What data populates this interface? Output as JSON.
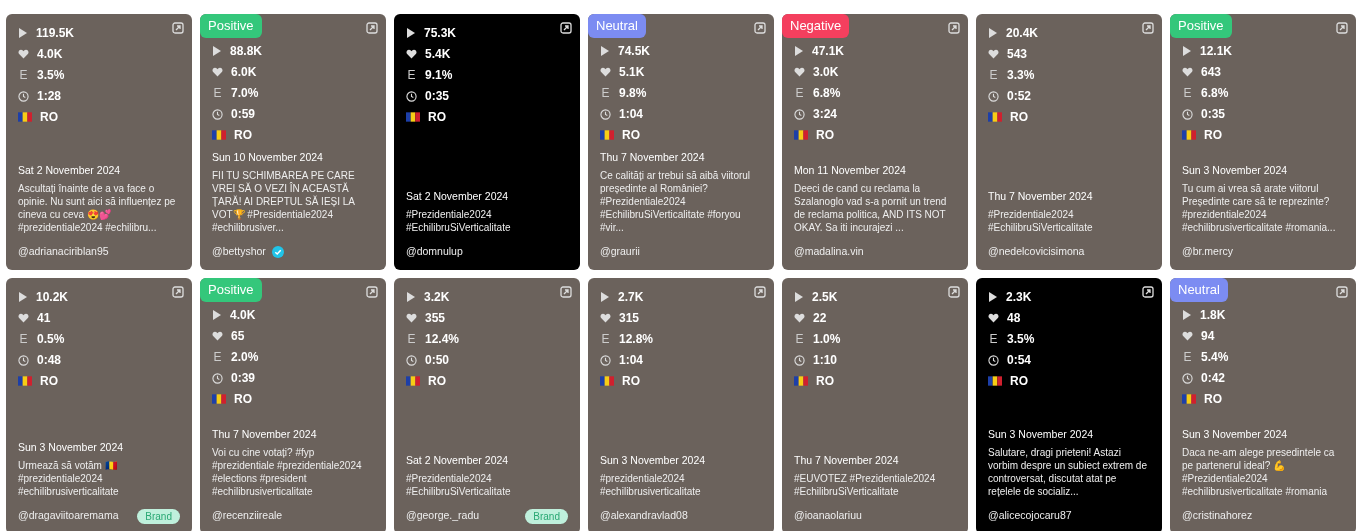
{
  "videos": [
    {
      "thumbnail": true,
      "plays": "119.5K",
      "likes": "4.0K",
      "engagement_label": "E",
      "engagement": "3.5%",
      "duration": "1:28",
      "country": "RO",
      "date": "Sat 2 November 2024",
      "caption": "Ascultați înainte de a va face o opinie. Nu sunt aici să influențez pe cineva cu ceva 😍💕 #prezidentiale2024 #echilibru...",
      "handle": "@adrianaciriblan95",
      "verified": false
    },
    {
      "thumbnail": true,
      "sentiment": {
        "kind": "positive",
        "label": "Positive"
      },
      "plays": "88.8K",
      "likes": "6.0K",
      "engagement_label": "E",
      "engagement": "7.0%",
      "duration": "0:59",
      "country": "RO",
      "date": "Sun 10 November 2024",
      "caption": "FII TU SCHIMBAREA PE CARE VREI SĂ O VEZI ÎN ACEASTĂ ȚARĂ! AI DREPTUL SĂ IEȘI LA VOT🏆 #Presidentiale2024 #echilibrusiver...",
      "handle": "@bettyshor",
      "verified": true
    },
    {
      "thumbnail": false,
      "plays": "75.3K",
      "likes": "5.4K",
      "engagement_label": "E",
      "engagement": "9.1%",
      "duration": "0:35",
      "country": "RO",
      "date": "Sat 2 November 2024",
      "caption": "#Prezidentiale2024 #EchilibruSiVerticalitate",
      "handle": "@domnulup",
      "verified": false
    },
    {
      "thumbnail": true,
      "sentiment": {
        "kind": "neutral",
        "label": "Neutral"
      },
      "plays": "74.5K",
      "likes": "5.1K",
      "engagement_label": "E",
      "engagement": "9.8%",
      "duration": "1:04",
      "country": "RO",
      "date": "Thu 7 November 2024",
      "caption": "Ce calități ar trebui să aibă viitorul președinte al României? #Prezidentiale2024 #EchilibruSiVerticalitate #foryou #vir...",
      "handle": "@graurii",
      "verified": false
    },
    {
      "thumbnail": true,
      "sentiment": {
        "kind": "negative",
        "label": "Negative"
      },
      "plays": "47.1K",
      "likes": "3.0K",
      "engagement_label": "E",
      "engagement": "6.8%",
      "duration": "3:24",
      "country": "RO",
      "date": "Mon 11 November 2024",
      "caption": "Deeci de cand cu reclama la Szalanoglo vad s-a pornit un trend de reclama politica, AND ITS NOT OKAY. Sa iti incurajezi ...",
      "handle": "@madalina.vin",
      "verified": false
    },
    {
      "thumbnail": true,
      "plays": "20.4K",
      "likes": "543",
      "engagement_label": "E",
      "engagement": "3.3%",
      "duration": "0:52",
      "country": "RO",
      "date": "Thu 7 November 2024",
      "caption": "#Prezidentiale2024 #EchilibruSiVerticalitate",
      "handle": "@nedelcovicisimona",
      "verified": false
    },
    {
      "thumbnail": true,
      "sentiment": {
        "kind": "positive",
        "label": "Positive"
      },
      "plays": "12.1K",
      "likes": "643",
      "engagement_label": "E",
      "engagement": "6.8%",
      "duration": "0:35",
      "country": "RO",
      "date": "Sun 3 November 2024",
      "caption": "Tu cum ai vrea să arate viitorul Președinte care să te reprezinte? #prezidentiale2024 #echilibrusiverticalitate #romania...",
      "handle": "@br.mercy",
      "verified": false
    },
    {
      "thumbnail": true,
      "plays": "10.2K",
      "likes": "41",
      "engagement_label": "E",
      "engagement": "0.5%",
      "duration": "0:48",
      "country": "RO",
      "date": "Sun 3 November 2024",
      "caption": "Urmează să votăm 🇷🇴 #prezidentiale2024 #echilibrusiverticalitate",
      "handle": "@dragaviitoaremama",
      "verified": false,
      "brand": "Brand"
    },
    {
      "thumbnail": true,
      "sentiment": {
        "kind": "positive",
        "label": "Positive"
      },
      "plays": "4.0K",
      "likes": "65",
      "engagement_label": "E",
      "engagement": "2.0%",
      "duration": "0:39",
      "country": "RO",
      "date": "Thu 7 November 2024",
      "caption": "Voi cu cine votați? #fyp #prezidentiale #prezidentiale2024 #elections #president #echilibrusiverticalitate",
      "handle": "@recenziireale",
      "verified": false
    },
    {
      "thumbnail": true,
      "plays": "3.2K",
      "likes": "355",
      "engagement_label": "E",
      "engagement": "12.4%",
      "duration": "0:50",
      "country": "RO",
      "date": "Sat 2 November 2024",
      "caption": "#Prezidentiale2024 #EchilibruSiVerticalitate",
      "handle": "@george._radu",
      "verified": false,
      "brand": "Brand"
    },
    {
      "thumbnail": true,
      "plays": "2.7K",
      "likes": "315",
      "engagement_label": "E",
      "engagement": "12.8%",
      "duration": "1:04",
      "country": "RO",
      "date": "Sun 3 November 2024",
      "caption": "#prezidentiale2024 #echilibrusiverticalitate",
      "handle": "@alexandravlad08",
      "verified": false
    },
    {
      "thumbnail": true,
      "plays": "2.5K",
      "likes": "22",
      "engagement_label": "E",
      "engagement": "1.0%",
      "duration": "1:10",
      "country": "RO",
      "date": "Thu 7 November 2024",
      "caption": "#EUVOTEZ #Prezidentiale2024 #EchilibruSiVerticalitate",
      "handle": "@ioanaolariuu",
      "verified": false
    },
    {
      "thumbnail": false,
      "plays": "2.3K",
      "likes": "48",
      "engagement_label": "E",
      "engagement": "3.5%",
      "duration": "0:54",
      "country": "RO",
      "date": "Sun 3 November 2024",
      "caption": "Salutare, dragi prieteni! Astazi vorbim despre un subiect extrem de controversat, discutat atat pe rețelele de socializ...",
      "handle": "@alicecojocaru87",
      "verified": false
    },
    {
      "thumbnail": true,
      "sentiment": {
        "kind": "neutral",
        "label": "Neutral"
      },
      "plays": "1.8K",
      "likes": "94",
      "engagement_label": "E",
      "engagement": "5.4%",
      "duration": "0:42",
      "country": "RO",
      "date": "Sun 3 November 2024",
      "caption": "Daca ne-am alege presedintele ca pe partenerul ideal? 💪 #Prezidentiale2024 #echilibrusiverticalitate #romania",
      "handle": "@cristinahorez",
      "verified": false
    }
  ]
}
